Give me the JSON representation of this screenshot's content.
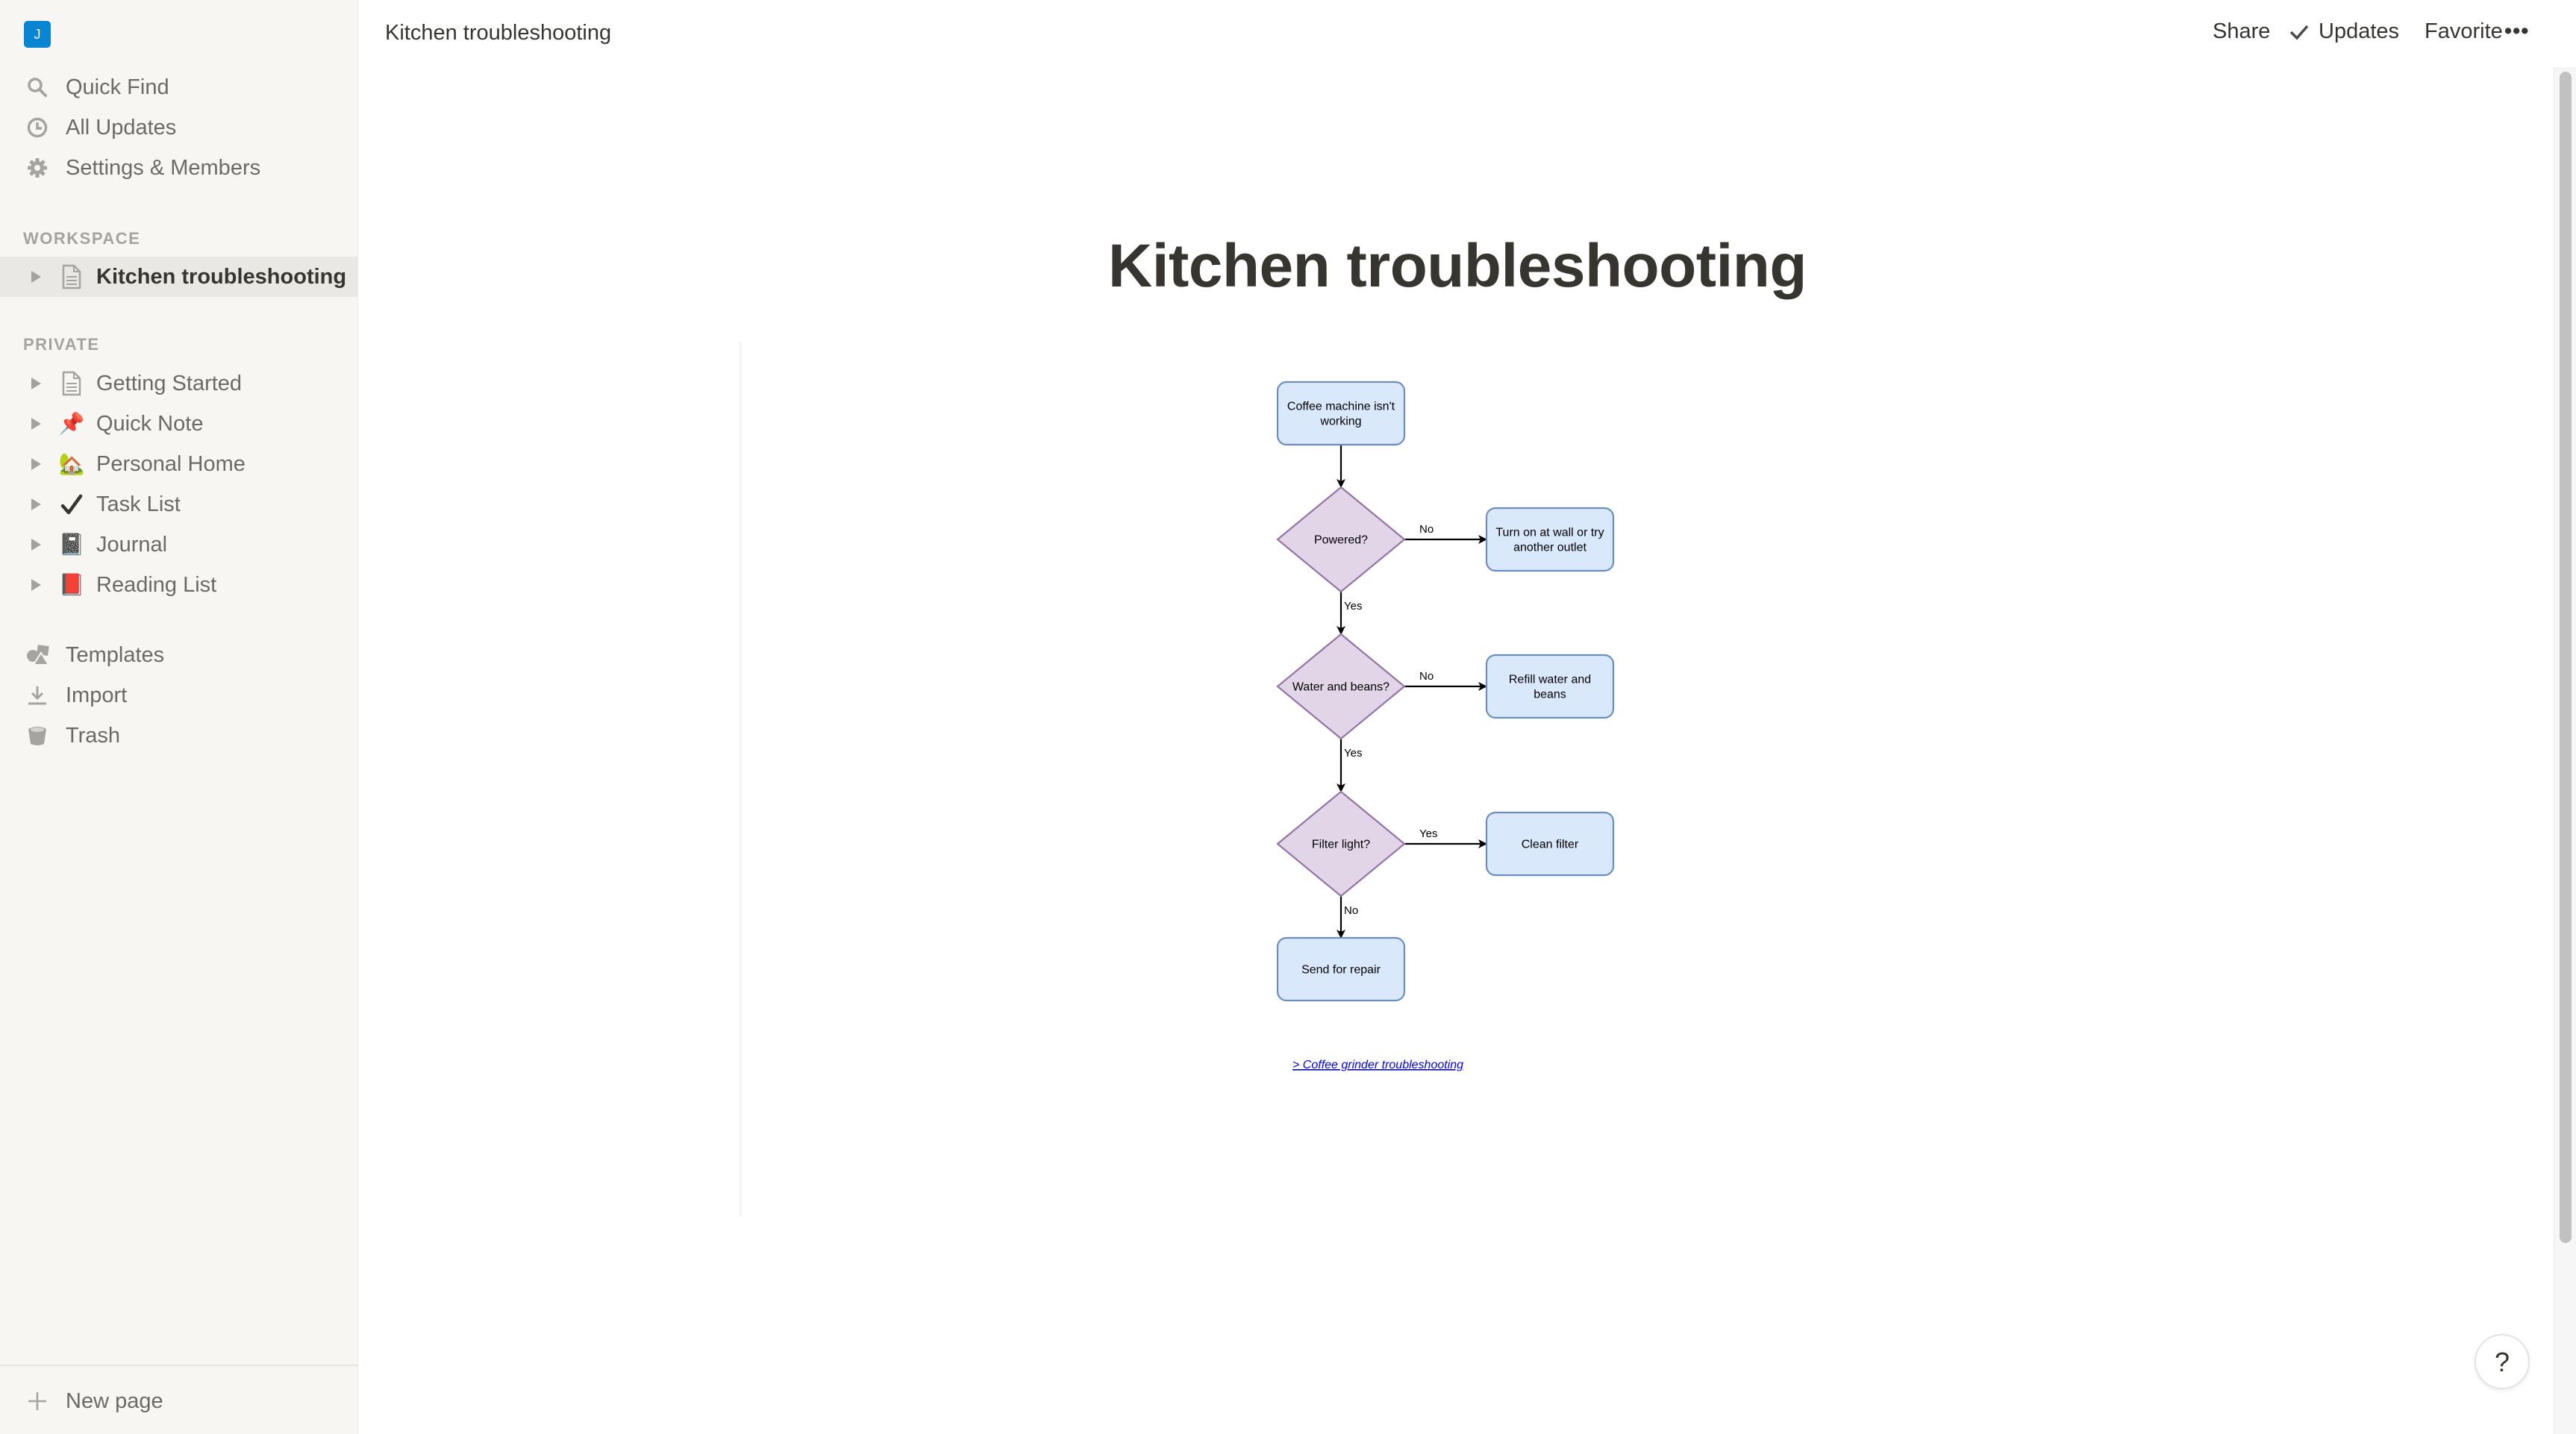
{
  "window": {
    "title": "Kitchen troubleshooting"
  },
  "sidebar": {
    "workspace_badge": "J",
    "workspace_badge_color": "#0a85d1",
    "nav": [
      {
        "label": "Quick Find",
        "icon": "search-icon"
      },
      {
        "label": "All Updates",
        "icon": "clock-icon"
      },
      {
        "label": "Settings & Members",
        "icon": "gear-icon"
      }
    ],
    "workspace_section": "WORKSPACE",
    "workspace_pages": [
      {
        "label": "Kitchen troubleshooting",
        "icon": "page-icon",
        "active": true
      }
    ],
    "private_section": "PRIVATE",
    "private_pages": [
      {
        "label": "Getting Started",
        "icon": "page-icon",
        "glyph": ""
      },
      {
        "label": "Quick Note",
        "icon": "pushpin-icon",
        "glyph": "📌"
      },
      {
        "label": "Personal Home",
        "icon": "house-icon",
        "glyph": "🏡"
      },
      {
        "label": "Task List",
        "icon": "checkmark-icon",
        "glyph": "✔️"
      },
      {
        "label": "Journal",
        "icon": "notebook-icon",
        "glyph": "📓"
      },
      {
        "label": "Reading List",
        "icon": "red-book-icon",
        "glyph": "📕"
      }
    ],
    "tools": [
      {
        "label": "Templates",
        "icon": "templates-icon"
      },
      {
        "label": "Import",
        "icon": "import-icon"
      },
      {
        "label": "Trash",
        "icon": "trash-icon"
      }
    ],
    "new_page": "New page"
  },
  "header": {
    "breadcrumb": "Kitchen troubleshooting",
    "share": "Share",
    "updates": "Updates",
    "favorite": "Favorite",
    "more": "•••"
  },
  "page": {
    "title": "Kitchen troubleshooting",
    "link": "> Coffee grinder troubleshooting"
  },
  "flowchart": {
    "colors": {
      "process_fill": "#dae8fc",
      "process_stroke": "#6c8ebf",
      "decision_fill": "#e1d5e7",
      "decision_stroke": "#9673a6",
      "edge": "#000000",
      "link": "#0000ee"
    },
    "nodes": [
      {
        "id": "start",
        "type": "process",
        "lines": [
          "Coffee machine isn't",
          "working"
        ]
      },
      {
        "id": "powered",
        "type": "decision",
        "lines": [
          "Powered?"
        ]
      },
      {
        "id": "outlet",
        "type": "process",
        "lines": [
          "Turn on at wall or try",
          "another outlet"
        ]
      },
      {
        "id": "water",
        "type": "decision",
        "lines": [
          "Water and beans?"
        ]
      },
      {
        "id": "refill",
        "type": "process",
        "lines": [
          "Refill water and",
          "beans"
        ]
      },
      {
        "id": "filter",
        "type": "decision",
        "lines": [
          "Filter light?"
        ]
      },
      {
        "id": "clean",
        "type": "process",
        "lines": [
          "Clean filter"
        ]
      },
      {
        "id": "repair",
        "type": "process",
        "lines": [
          "Send for repair"
        ]
      }
    ],
    "edges": [
      {
        "from": "start",
        "to": "powered",
        "label": ""
      },
      {
        "from": "powered",
        "to": "outlet",
        "label": "No"
      },
      {
        "from": "powered",
        "to": "water",
        "label": "Yes"
      },
      {
        "from": "water",
        "to": "refill",
        "label": "No"
      },
      {
        "from": "water",
        "to": "filter",
        "label": "Yes"
      },
      {
        "from": "filter",
        "to": "clean",
        "label": "Yes"
      },
      {
        "from": "filter",
        "to": "repair",
        "label": "No"
      }
    ]
  },
  "help": {
    "label": "?"
  }
}
